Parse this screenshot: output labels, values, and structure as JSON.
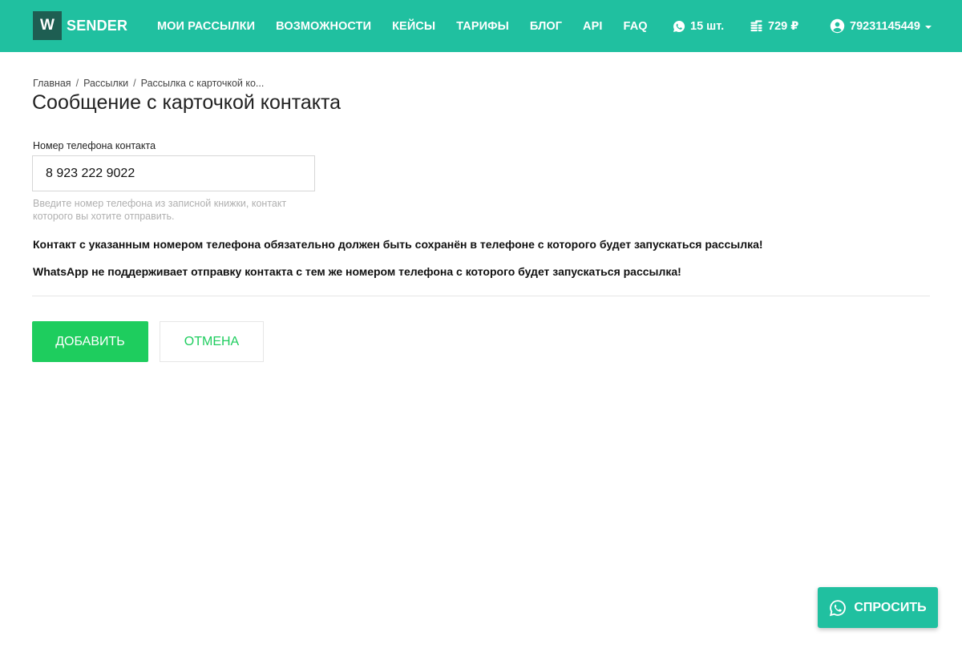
{
  "brand": {
    "letter": "W",
    "name": "SENDER"
  },
  "nav": {
    "items": [
      "МОИ РАССЫЛКИ",
      "ВОЗМОЖНОСТИ",
      "КЕЙСЫ",
      "ТАРИФЫ",
      "БЛОГ",
      "API",
      "FAQ"
    ]
  },
  "header_stats": {
    "chats": "15 шт.",
    "balance": "729 ₽",
    "user_phone": "79231145449"
  },
  "breadcrumb": [
    "Главная",
    "Рассылки",
    "Рассылка с карточкой ко..."
  ],
  "page_title": "Сообщение с карточкой контакта",
  "form": {
    "phone_label": "Номер телефона контакта",
    "phone_value": "8 923 222 9022",
    "phone_hint": "Введите номер телефона из записной книжки, контакт которого вы хотите отправить.",
    "warning_1": "Контакт с указанным номером телефона обязательно должен быть сохранён в телефоне с которого будет запускаться рассылка!",
    "warning_2": "WhatsApp не поддерживает отправку контакта с тем же номером телефона с которого будет запускаться рассылка!"
  },
  "buttons": {
    "add": "ДОБАВИТЬ",
    "cancel": "ОТМЕНА",
    "ask": "СПРОСИТЬ"
  },
  "colors": {
    "header": "#20c0a0",
    "logo_box": "#1e5e52",
    "primary": "#1ecd5e",
    "hint": "#b0b0b0"
  },
  "icons": {
    "chats": "whatsapp-icon",
    "balance": "coins-icon",
    "user": "user-circle-icon",
    "ask": "whatsapp-icon"
  }
}
